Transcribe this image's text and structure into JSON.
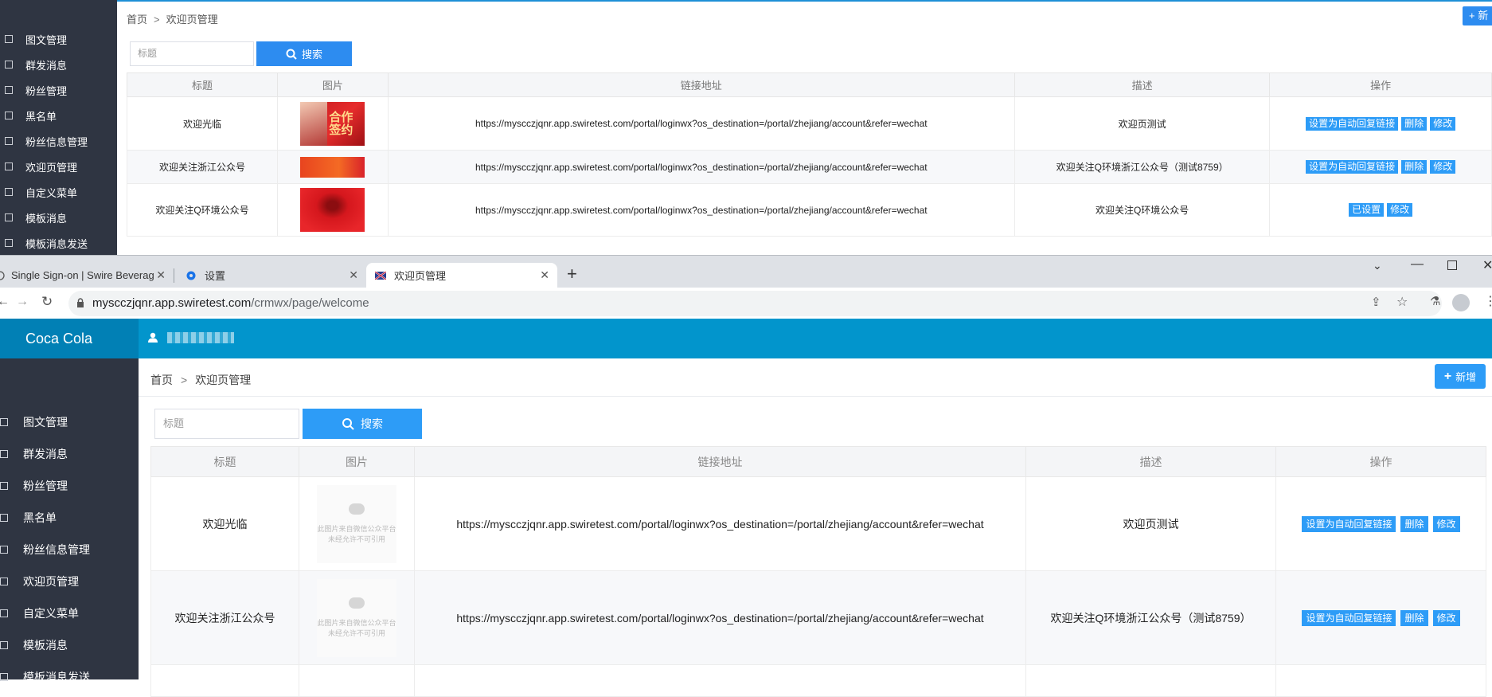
{
  "top_window": {
    "breadcrumb": {
      "home": "首页",
      "sep": ">",
      "current": "欢迎页管理"
    },
    "add_button": "+ 新",
    "sidebar": [
      "图文管理",
      "群发消息",
      "粉丝管理",
      "黑名单",
      "粉丝信息管理",
      "欢迎页管理",
      "自定义菜单",
      "模板消息",
      "模板消息发送"
    ],
    "search": {
      "placeholder": "标题",
      "button": "搜索"
    },
    "table": {
      "headers": [
        "标题",
        "图片",
        "链接地址",
        "描述",
        "操作"
      ],
      "rows": [
        {
          "title": "欢迎光临",
          "link": "https://myscczjqnr.app.swiretest.com/portal/loginwx?os_destination=/portal/zhejiang/account&refer=wechat",
          "desc": "欢迎页测试",
          "ops": [
            "设置为自动回复链接",
            "删除",
            "修改"
          ],
          "image_text": "合作\n签约"
        },
        {
          "title": "欢迎关注浙江公众号",
          "link": "https://myscczjqnr.app.swiretest.com/portal/loginwx?os_destination=/portal/zhejiang/account&refer=wechat",
          "desc": "欢迎关注Q环境浙江公众号（测试8759）",
          "ops": [
            "设置为自动回复链接",
            "删除",
            "修改"
          ]
        },
        {
          "title": "欢迎关注Q环境公众号",
          "link": "https://myscczjqnr.app.swiretest.com/portal/loginwx?os_destination=/portal/zhejiang/account&refer=wechat",
          "desc": "欢迎关注Q环境公众号",
          "ops": [
            "已设置",
            "修改"
          ]
        }
      ]
    }
  },
  "browser": {
    "tabs": [
      {
        "title": "Single Sign-on | Swire Beverag",
        "icon": "globe-icon"
      },
      {
        "title": "设置",
        "icon": "gear-icon"
      },
      {
        "title": "欢迎页管理",
        "icon": "flag-icon"
      }
    ],
    "url_host": "myscczjqnr.app.swiretest.com",
    "url_path": "/crmwx/page/welcome"
  },
  "app": {
    "brand": "Coca Cola",
    "breadcrumb": {
      "home": "首页",
      "sep": ">",
      "current": "欢迎页管理"
    },
    "add_button": "新增",
    "sidebar": [
      "图文管理",
      "群发消息",
      "粉丝管理",
      "黑名单",
      "粉丝信息管理",
      "欢迎页管理",
      "自定义菜单",
      "模板消息",
      "模板消息发送"
    ],
    "search": {
      "placeholder": "标题",
      "button": "搜索"
    },
    "table": {
      "headers": [
        "标题",
        "图片",
        "链接地址",
        "描述",
        "操作"
      ],
      "image_placeholder": "此图片来自微信公众平台\n未经允许不可引用",
      "rows": [
        {
          "title": "欢迎光临",
          "link": "https://myscczjqnr.app.swiretest.com/portal/loginwx?os_destination=/portal/zhejiang/account&refer=wechat",
          "desc": "欢迎页测试",
          "ops": [
            "设置为自动回复链接",
            "删除",
            "修改"
          ]
        },
        {
          "title": "欢迎关注浙江公众号",
          "link": "https://myscczjqnr.app.swiretest.com/portal/loginwx?os_destination=/portal/zhejiang/account&refer=wechat",
          "desc": "欢迎关注Q环境浙江公众号（测试8759）",
          "ops": [
            "设置为自动回复链接",
            "删除",
            "修改"
          ]
        }
      ]
    }
  },
  "colors": {
    "primary": "#2d9cf7",
    "header": "#0295cc",
    "sidebar": "#2f3542",
    "brand_bg": "#0180b5"
  }
}
